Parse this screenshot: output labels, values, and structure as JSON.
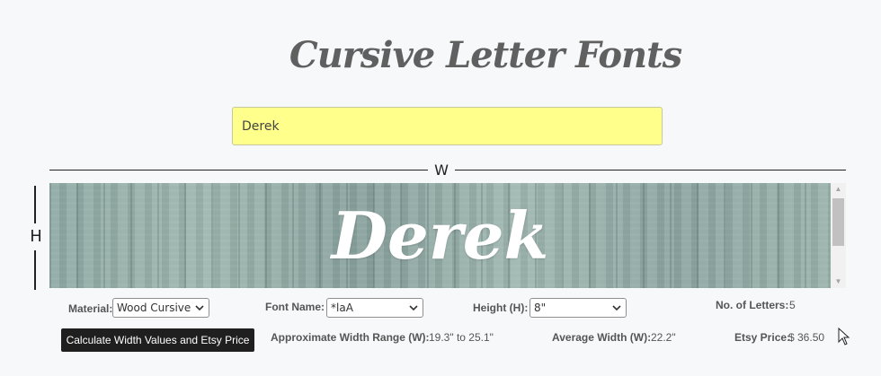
{
  "page": {
    "title": "Cursive Letter Fonts"
  },
  "name_input": {
    "value": "Derek"
  },
  "dimensions": {
    "width_label": "W",
    "height_label": "H"
  },
  "preview": {
    "text": "Derek",
    "background": "wood-planks"
  },
  "controls": {
    "material_label": "Material:",
    "material_value": "Wood Cursive",
    "font_label": "Font Name:",
    "font_value": "*laA",
    "height_label": "Height (H):",
    "height_value": "8\"",
    "letters_label": "No. of Letters:",
    "letters_value": "5"
  },
  "results": {
    "calc_button": "Calculate Width Values and Etsy Price",
    "range_label": "Approximate Width Range (W):",
    "range_value": "19.3\" to 25.1\"",
    "avg_label": "Average Width (W):",
    "avg_value": "22.2\"",
    "price_label": "Etsy Price:",
    "price_value": "$ 36.50"
  },
  "colors": {
    "input_bg": "#ffff8c",
    "button_bg": "#1f1f1f",
    "page_bg": "#f7f8fa"
  }
}
